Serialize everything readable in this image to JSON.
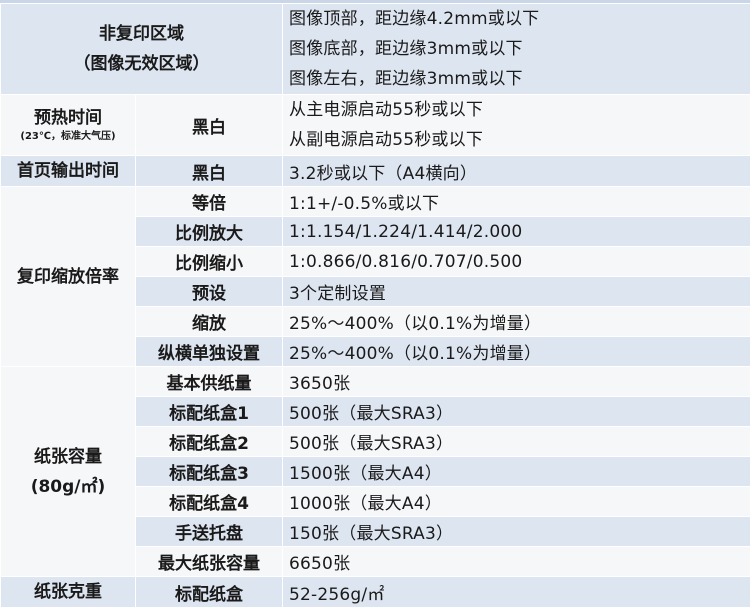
{
  "rows": {
    "non_copy": {
      "cat": "非复印区域",
      "cat2": "（图像无效区域）",
      "lines": [
        "图像顶部，距边缘4.2mm或以下",
        "图像底部，距边缘3mm或以下",
        "图像左右，距边缘3mm或以下"
      ]
    },
    "warmup": {
      "cat": "预热时间",
      "cat_sub": "(23℃，标准大气压)",
      "sub": "黑白",
      "lines": [
        "从主电源启动55秒或以下",
        "从副电源启动55秒或以下"
      ]
    },
    "first_copy": {
      "cat": "首页输出时间",
      "sub": "黑白",
      "value": "3.2秒或以下（A4横向）"
    },
    "zoom": {
      "cat": "复印缩放倍率",
      "items": [
        {
          "sub": "等倍",
          "value": "1:1+/-0.5%或以下"
        },
        {
          "sub": "比例放大",
          "value": "1:1.154/1.224/1.414/2.000"
        },
        {
          "sub": "比例缩小",
          "value": "1:0.866/0.816/0.707/0.500"
        },
        {
          "sub": "预设",
          "value": "3个定制设置"
        },
        {
          "sub": "缩放",
          "value": "25%～400%（以0.1%为增量）"
        },
        {
          "sub": "纵横单独设置",
          "value": "25%～400%（以0.1%为增量）"
        }
      ]
    },
    "capacity": {
      "cat": "纸张容量",
      "cat2": "(80g/㎡)",
      "items": [
        {
          "sub": "基本供纸量",
          "value": "3650张"
        },
        {
          "sub": "标配纸盒1",
          "value": "500张（最大SRA3）"
        },
        {
          "sub": "标配纸盒2",
          "value": "500张（最大SRA3）"
        },
        {
          "sub": "标配纸盒3",
          "value": "1500张（最大A4）"
        },
        {
          "sub": "标配纸盒4",
          "value": "1000张（最大A4）"
        },
        {
          "sub": "手送托盘",
          "value": "150张（最大SRA3）"
        },
        {
          "sub": "最大纸张容量",
          "value": "6650张"
        }
      ]
    },
    "weight": {
      "cat": "纸张克重",
      "sub": "标配纸盒",
      "value": "52-256g/㎡"
    }
  }
}
